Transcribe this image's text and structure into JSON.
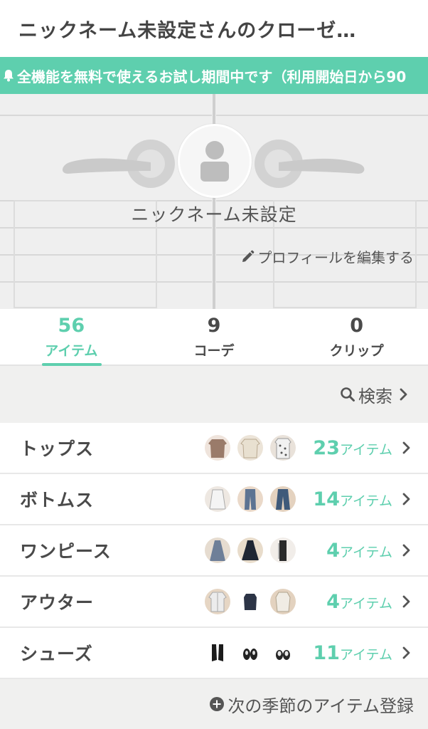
{
  "header": {
    "title": "ニックネーム未設定さんのクローゼ…"
  },
  "banner": {
    "text": "全機能を無料で使えるお試し期間中です（利用開始日から90"
  },
  "profile": {
    "nickname": "ニックネーム未設定",
    "edit_label": "プロフィールを編集する"
  },
  "stats": [
    {
      "value": "56",
      "label": "アイテム",
      "active": true
    },
    {
      "value": "9",
      "label": "コーデ",
      "active": false
    },
    {
      "value": "0",
      "label": "クリップ",
      "active": false
    }
  ],
  "search": {
    "label": "検索"
  },
  "categories": [
    {
      "name": "トップス",
      "count": "23",
      "unit": "アイテム"
    },
    {
      "name": "ボトムス",
      "count": "14",
      "unit": "アイテム"
    },
    {
      "name": "ワンピース",
      "count": "4",
      "unit": "アイテム"
    },
    {
      "name": "アウター",
      "count": "4",
      "unit": "アイテム"
    },
    {
      "name": "シューズ",
      "count": "11",
      "unit": "アイテム"
    }
  ],
  "footer": {
    "label": "次の季節のアイテム登録"
  },
  "colors": {
    "accent": "#5ecfae",
    "text": "#4a4a4a",
    "bar_bg": "#f0f0ef"
  }
}
